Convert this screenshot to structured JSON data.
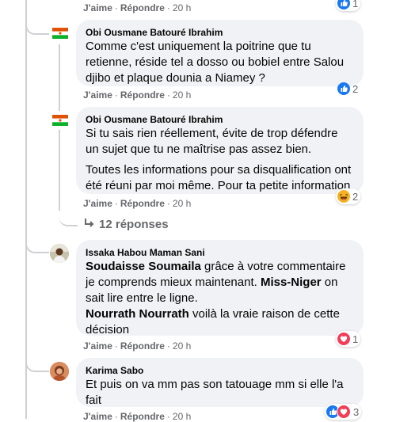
{
  "colors": {
    "like": "#1877f2",
    "love": "#f33e58",
    "haha": "#f7b125",
    "bubble": "#f0f2f5",
    "meta": "#65676b"
  },
  "top_actions": {
    "like": "J'aime",
    "reply": "Répondre",
    "time": "20 h",
    "reaction_count": "1"
  },
  "comment1": {
    "author": "Obi Ousmane Batouré Ibrahim",
    "text": "Comme c'est uniquement la poitrine que tu retienne, réside tel a dosso ou bobiel entre Salou djibo et plaque dounia a Niamey ?",
    "like": "J'aime",
    "reply": "Répondre",
    "time": "20 h",
    "reaction_icon": "like-icon",
    "reaction_count": "2"
  },
  "comment2": {
    "author": "Obi Ousmane Batouré Ibrahim",
    "text_p1": "Si tu sais rien réellement, évite de trop défendre un sujet que tu ne maîtrise pas assez bien.",
    "text_p2": "Toutes les informations pour sa disqualification ont été réuni par moi même. Pour ta petite information",
    "like": "J'aime",
    "reply": "Répondre",
    "time": "20 h",
    "reaction_icon": "haha-icon",
    "reaction_count": "2"
  },
  "replies_link": {
    "icon": "reply-arrow-icon",
    "label": "12 réponses"
  },
  "comment3": {
    "author": "Issaka Habou Maman Sani",
    "mention1": "Soudaisse Soumaila",
    "text1": " grâce à votre commentaire je comprends mieux maintenant. ",
    "mention2": "Miss-Niger",
    "text2": " on sait lire entre le ligne.",
    "mention3": "Nourrath Nourrath",
    "text3": " voilà la vraie raison de cette décision",
    "like": "J'aime",
    "reply": "Répondre",
    "time": "20 h",
    "reaction_icon": "love-icon",
    "reaction_count": "1"
  },
  "comment4": {
    "author": "Karima Sabo",
    "text": "Et puis on va mm pas son tatouage mm si elle l'a fait",
    "like": "J'aime",
    "reply": "Répondre",
    "time": "20 h",
    "reaction_icons": [
      "like-icon",
      "love-icon"
    ],
    "reaction_count": "3"
  }
}
